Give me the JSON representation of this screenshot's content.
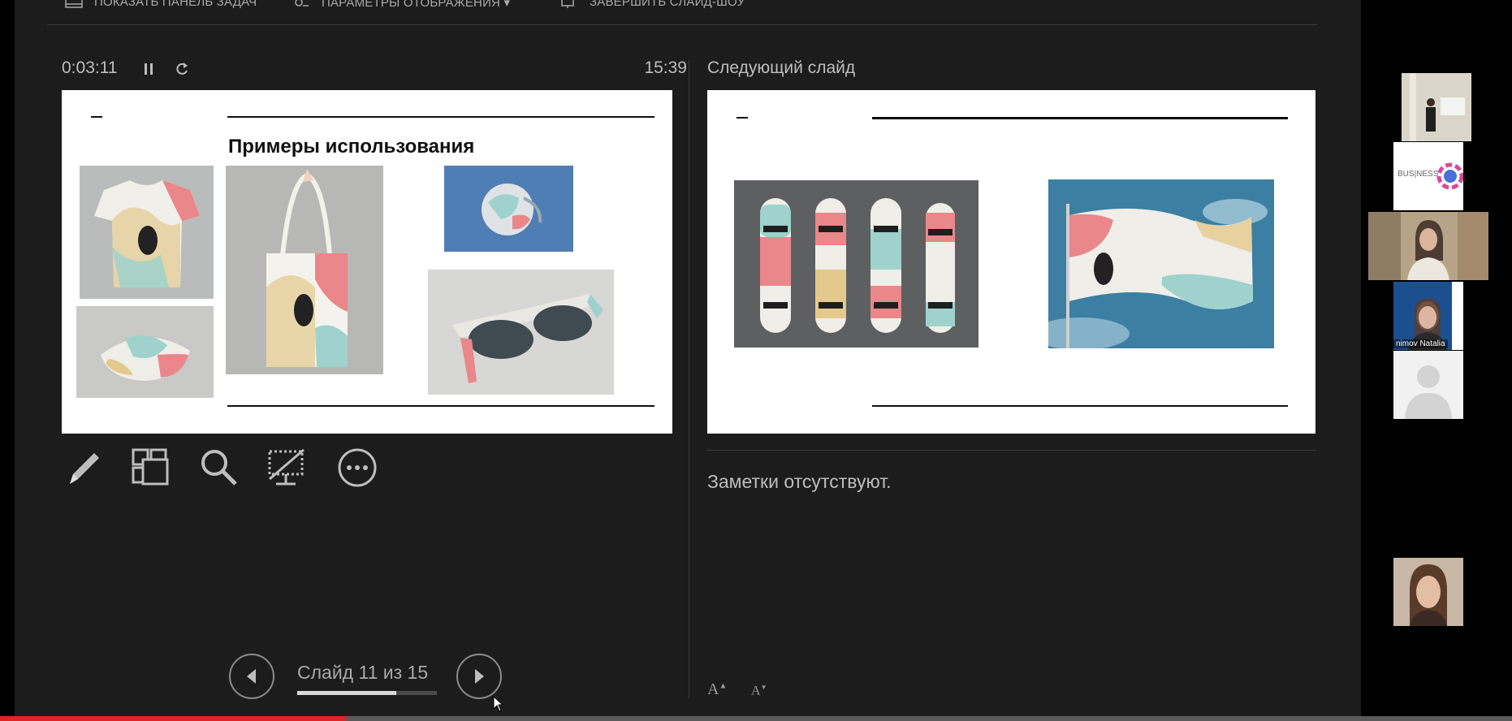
{
  "toolbar": {
    "taskbar_label": "ПОКАЗАТЬ ПАНЕЛЬ ЗАДАЧ",
    "display_settings_label": "ПАРАМЕТРЫ ОТОБРАЖЕНИЯ ▾",
    "end_show_label": "ЗАВЕРШИТЬ СЛАЙД-ШОУ"
  },
  "timer": {
    "elapsed": "0:03:11",
    "clock": "15:39"
  },
  "current_slide": {
    "title": "Примеры использования"
  },
  "next_slide": {
    "label": "Следующий слайд"
  },
  "tools": [
    "pen-icon",
    "slides-grid-icon",
    "zoom-icon",
    "black-screen-icon",
    "more-options-icon"
  ],
  "notes": {
    "text": "Заметки отсутствуют."
  },
  "font_controls": {
    "increase": "A",
    "decrease": "A"
  },
  "navigation": {
    "counter": "Слайд 11 из 15",
    "current": 11,
    "total": 15,
    "progress_fraction": 0.71
  },
  "video": {
    "progress_fraction": 0.228
  },
  "participants": {
    "tiles": [
      {
        "label": ""
      },
      {
        "label": ""
      },
      {
        "label": ""
      },
      {
        "label": "nimov Natalia"
      },
      {
        "label": ""
      },
      {
        "label": ""
      }
    ],
    "logo_text": "BUS|NESS"
  },
  "colors": {
    "background": "#1c1c1c",
    "accent_red": "#e02424",
    "text_muted": "#bdbdbd"
  }
}
